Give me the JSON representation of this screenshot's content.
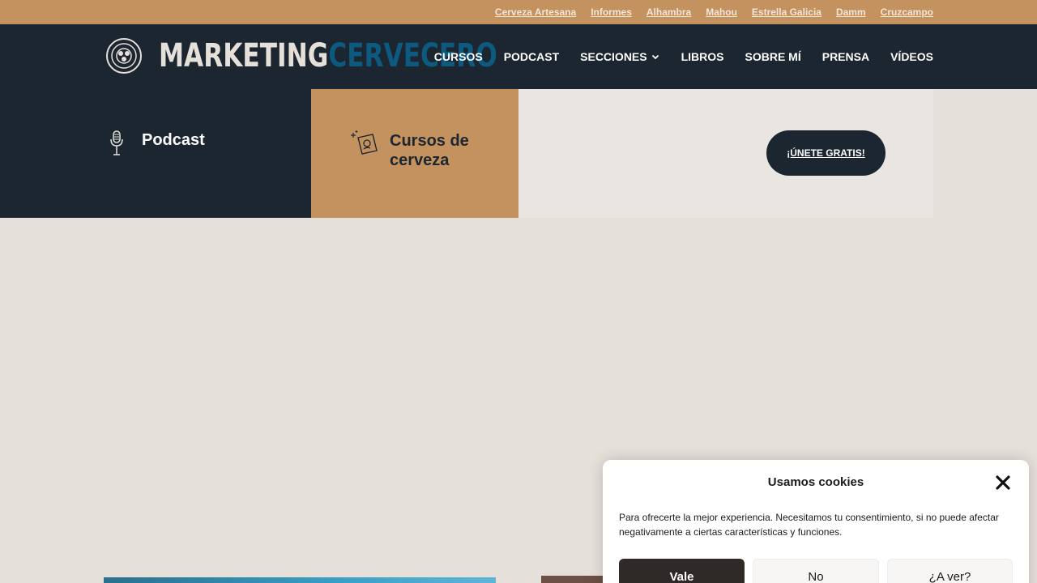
{
  "topbar": {
    "links": [
      "Cerveza Artesana",
      "Informes",
      "Alhambra",
      "Mahou",
      "Estrella Galicia",
      "Damm",
      "Cruzcampo"
    ]
  },
  "header": {
    "logo_word_1": "MARKETING",
    "logo_word_2": "CERVECERO",
    "nav": {
      "cursos": "CURSOS",
      "podcast": "PODCAST",
      "secciones": "SECCIONES",
      "libros": "LIBROS",
      "sobre_mi": "SOBRE MÍ",
      "prensa": "PRENSA",
      "videos": "VÍDEOS"
    }
  },
  "features": {
    "podcast_label": "Podcast",
    "cursos_label": "Cursos de cerveza",
    "join_label": "¡ÚNETE GRATIS!"
  },
  "cookie": {
    "title": "Usamos cookies",
    "message": "Para ofrecerte la mejor experiencia. Necesitamos tu consentimiento, si no puede afectar negativamente a ciertas características y funciones.",
    "accept": "Vale",
    "deny": "No",
    "prefs": "¿A ver?"
  },
  "colors": {
    "topbar": "#c4925f",
    "header": "#1c2630",
    "brand_blue": "#0d5a80",
    "background": "#e6e0da"
  }
}
